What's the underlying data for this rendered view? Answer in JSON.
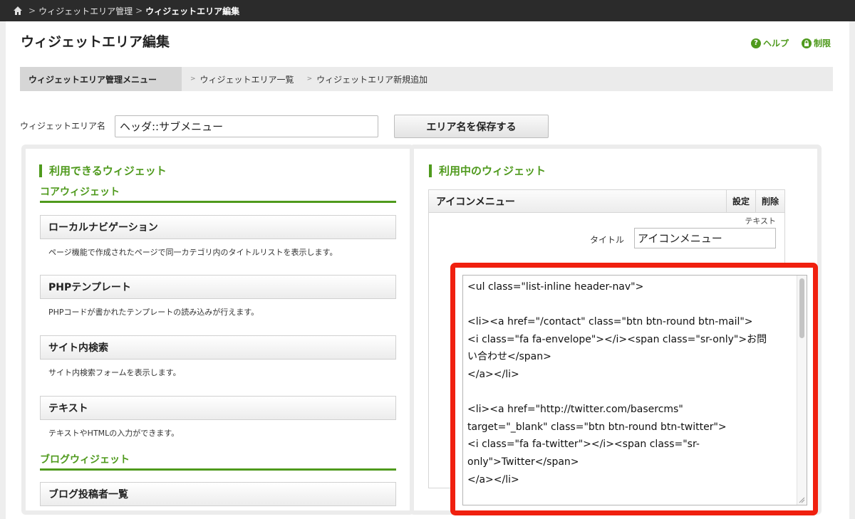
{
  "breadcrumb": {
    "items": [
      "ウィジェットエリア管理",
      "ウィジェットエリア編集"
    ],
    "separator": ">"
  },
  "page": {
    "title": "ウィジェットエリア編集",
    "help_label": "ヘルプ",
    "restrict_label": "制限"
  },
  "submenu": {
    "heading": "ウィジェットエリア管理メニュー",
    "links": [
      "ウィジェットエリア一覧",
      "ウィジェットエリア新規追加"
    ]
  },
  "area_name": {
    "label": "ウィジェットエリア名",
    "value": "ヘッダ::サブメニュー",
    "save_button": "エリア名を保存する"
  },
  "available": {
    "title": "利用できるウィジェット",
    "core_section": "コアウィジェット",
    "widgets": [
      {
        "name": "ローカルナビゲーション",
        "desc": "ページ機能で作成されたページで同一カテゴリ内のタイトルリストを表示します。"
      },
      {
        "name": "PHPテンプレート",
        "desc": "PHPコードが書かれたテンプレートの読み込みが行えます。"
      },
      {
        "name": "サイト内検索",
        "desc": "サイト内検索フォームを表示します。"
      },
      {
        "name": "テキスト",
        "desc": "テキストやHTMLの入力ができます。"
      }
    ],
    "blog_section": "ブログウィジェット",
    "blog_widgets": [
      {
        "name": "ブログ投稿者一覧"
      }
    ]
  },
  "used": {
    "title": "利用中のウィジェット",
    "widget_name": "アイコンメニュー",
    "settings_button": "設定",
    "delete_button": "削除",
    "type_label": "テキスト",
    "title_label": "タイトル",
    "title_value": "アイコンメニュー",
    "code_lines": [
      "<ul class=\"list-inline header-nav\">",
      "",
      "<li><a href=\"/contact\" class=\"btn btn-round btn-mail\">",
      "<i class=\"fa fa-envelope\"></i><span class=\"sr-only\">お問",
      "い合わせ</span>",
      "</a></li>",
      "",
      "<li><a href=\"http://twitter.com/basercms\"",
      "target=\"_blank\" class=\"btn btn-round btn-twitter\">",
      "<i class=\"fa fa-twitter\"></i><span class=\"sr-",
      "only\">Twitter</span>",
      "</a></li>"
    ]
  },
  "colors": {
    "accent_green": "#4f9a1d",
    "highlight_red": "#f0200f",
    "topbar": "#2b2b2b"
  }
}
